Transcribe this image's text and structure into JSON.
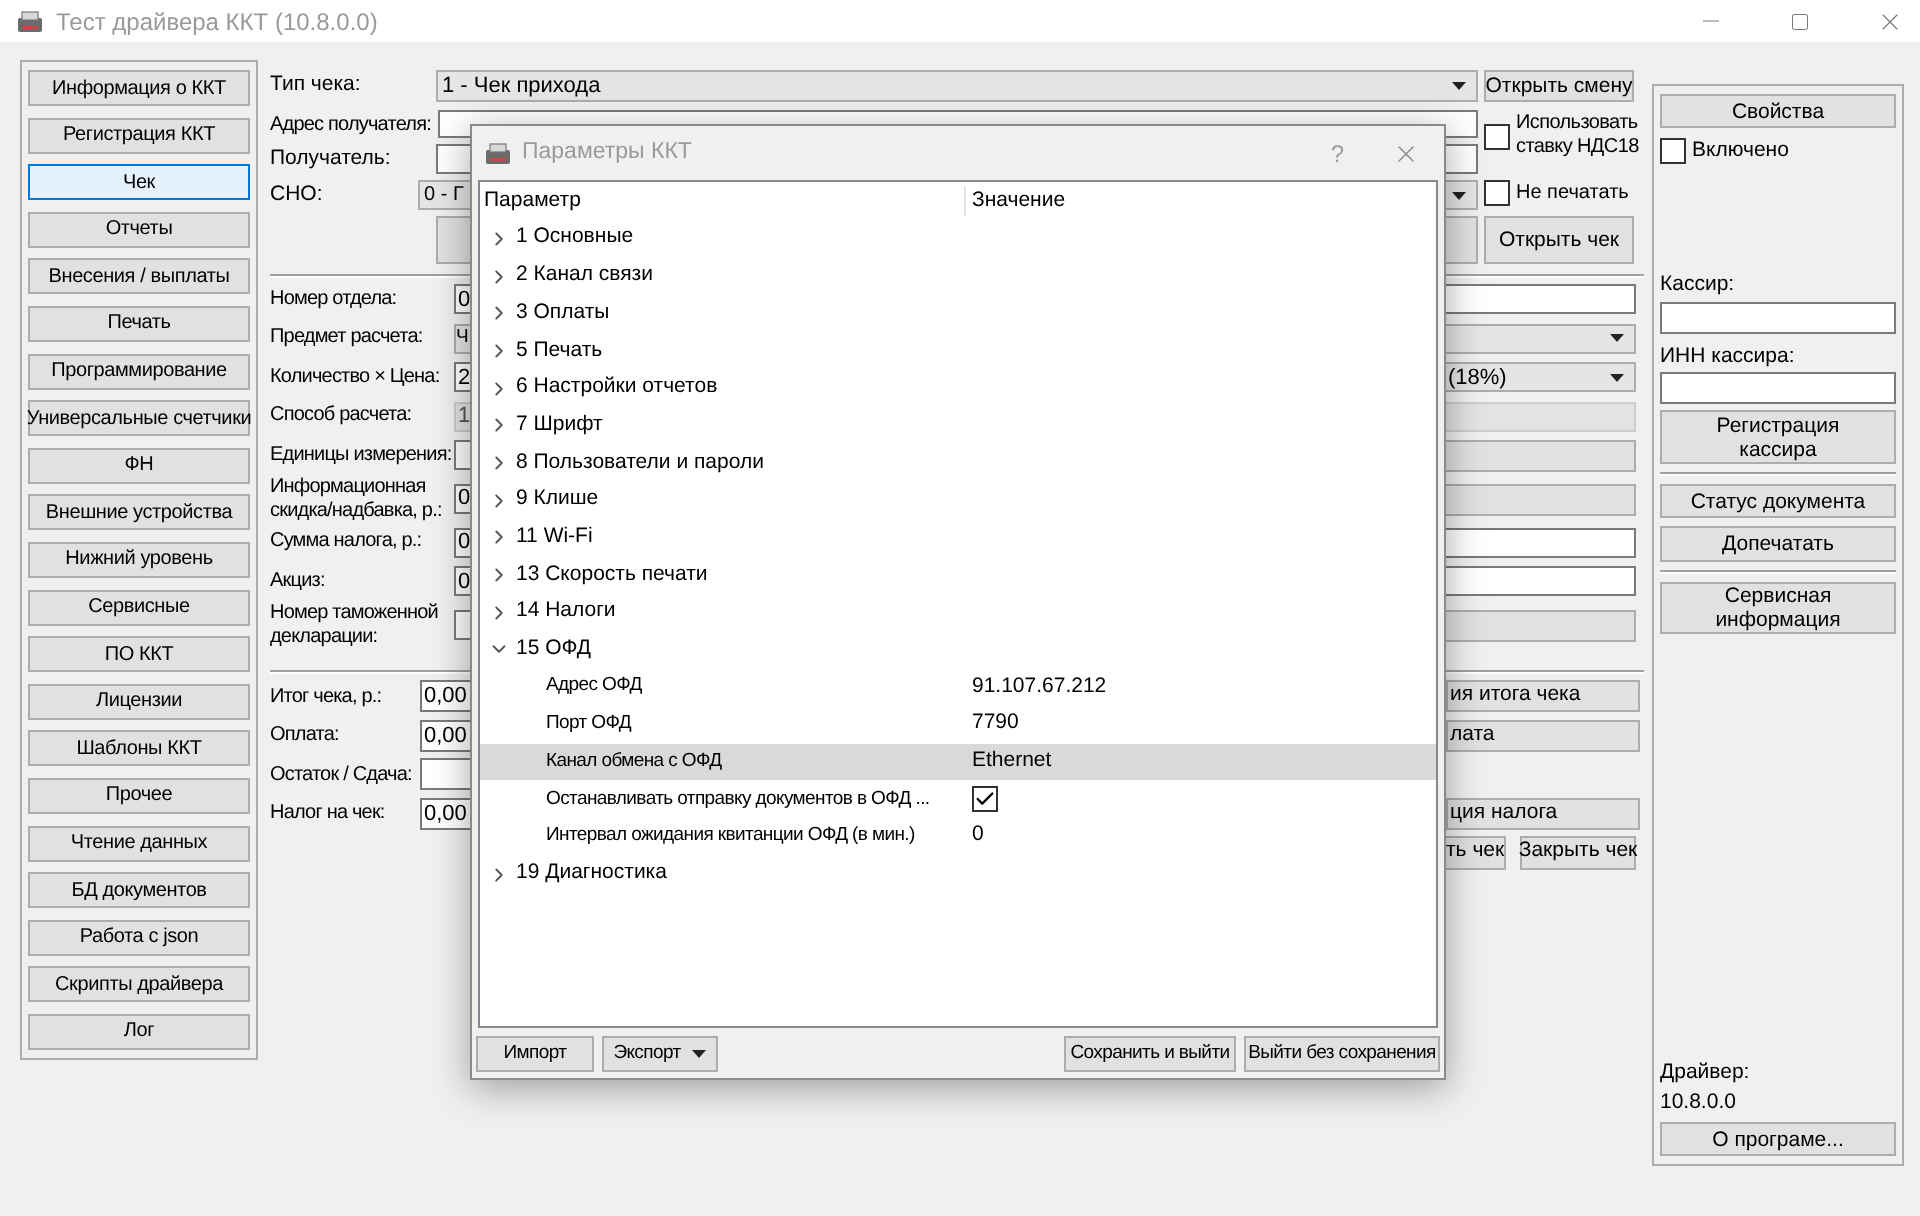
{
  "window": {
    "title": "Тест драйвера ККТ (10.8.0.0)"
  },
  "sidebar": {
    "items": [
      {
        "label": "Информация о ККТ",
        "selected": false
      },
      {
        "label": "Регистрация ККТ",
        "selected": false
      },
      {
        "label": "Чек",
        "selected": true
      },
      {
        "label": "Отчеты",
        "selected": false
      },
      {
        "label": "Внесения / выплаты",
        "selected": false
      },
      {
        "label": "Печать",
        "selected": false
      },
      {
        "label": "Программирование",
        "selected": false
      },
      {
        "label": "Универсальные счетчики",
        "selected": false
      },
      {
        "label": "ФН",
        "selected": false
      },
      {
        "label": "Внешние устройства",
        "selected": false
      },
      {
        "label": "Нижний уровень",
        "selected": false
      },
      {
        "label": "Сервисные",
        "selected": false
      },
      {
        "label": "ПО ККТ",
        "selected": false
      },
      {
        "label": "Лицензии",
        "selected": false
      },
      {
        "label": "Шаблоны ККТ",
        "selected": false
      },
      {
        "label": "Прочее",
        "selected": false
      },
      {
        "label": "Чтение данных",
        "selected": false
      },
      {
        "label": "БД документов",
        "selected": false
      },
      {
        "label": "Работа с json",
        "selected": false
      },
      {
        "label": "Скрипты драйвера",
        "selected": false
      },
      {
        "label": "Лог",
        "selected": false
      }
    ]
  },
  "header": {
    "receipt_type": {
      "label": "Тип чека:",
      "value": "1 - Чек прихода"
    },
    "address": {
      "label": "Адрес получателя:"
    },
    "recipient": {
      "label": "Получатель:"
    },
    "tax_system": {
      "label": "СНО:",
      "value": "0 - Г"
    },
    "open_shift": "Открыть смену",
    "use_vat18": {
      "label": "Использовать ставку НДС18",
      "checked": false
    },
    "no_print": {
      "label": "Не печатать",
      "checked": false
    },
    "open_receipt": "Открыть чек"
  },
  "item_fields": [
    {
      "label": "Номер отдела:",
      "kind": "input",
      "value": "0"
    },
    {
      "label": "Предмет расчета:",
      "kind": "dropdown",
      "value": "Ч"
    },
    {
      "label": "Количество × Цена:",
      "kind": "input",
      "value": "2",
      "right": {
        "kind": "dropdown",
        "value": "(18%)"
      }
    },
    {
      "label": "Способ расчета:",
      "kind": "disabled",
      "value": "1"
    },
    {
      "label": "Единицы измерения:",
      "kind": "input",
      "right": {
        "kind": "button"
      }
    },
    {
      "label": "Информационная скидка/надбавка, р.:",
      "kind": "input",
      "value": "0",
      "right": {
        "kind": "button"
      }
    },
    {
      "label": "Сумма налога, р.:",
      "kind": "input",
      "value": "0"
    },
    {
      "label": "Акциз:",
      "kind": "input",
      "value": "0"
    },
    {
      "label": "Номер таможенной декларации:",
      "kind": "input",
      "right": {
        "kind": "button"
      }
    }
  ],
  "totals": [
    {
      "label": "Итог чека, р.:",
      "value": "0,00",
      "button": "ия итога чека"
    },
    {
      "label": "Оплата:",
      "value": "0,00",
      "button": "лата"
    },
    {
      "label": "Остаток / Сдача:"
    },
    {
      "label": "Налог на чек:",
      "value": "0,00",
      "button": "ция налога"
    }
  ],
  "actions": [
    "ть чек",
    "Закрыть чек"
  ],
  "right_panel": {
    "properties": "Свойства",
    "enabled": {
      "label": "Включено",
      "checked": false
    },
    "cashier_label": "Кассир:",
    "inn_label": "ИНН кассира:",
    "register_cashier": "Регистрация кассира",
    "doc_status": "Статус документа",
    "reprint": "Допечатать",
    "service_info": "Сервисная информация",
    "driver_label": "Драйвер:",
    "driver_version": "10.8.0.0",
    "about": "О програме..."
  },
  "dialog": {
    "title": "Параметры ККТ",
    "help": "?",
    "columns": [
      "Параметр",
      "Значение"
    ],
    "groups": [
      {
        "label": "1 Основные",
        "expanded": false,
        "selected": false
      },
      {
        "label": "2 Канал связи",
        "expanded": false,
        "selected": false
      },
      {
        "label": "3 Оплаты",
        "expanded": false,
        "selected": false
      },
      {
        "label": "5 Печать",
        "expanded": false,
        "selected": false
      },
      {
        "label": "6 Настройки отчетов",
        "expanded": false,
        "selected": false
      },
      {
        "label": "7 Шрифт",
        "expanded": false,
        "selected": false
      },
      {
        "label": "8 Пользователи и пароли",
        "expanded": false,
        "selected": false
      },
      {
        "label": "9 Клише",
        "expanded": false,
        "selected": false
      },
      {
        "label": "11 Wi-Fi",
        "expanded": false,
        "selected": false
      },
      {
        "label": "13 Скорость печати",
        "expanded": false,
        "selected": false
      },
      {
        "label": "14 Налоги",
        "expanded": false,
        "selected": false
      },
      {
        "label": "15 ОФД",
        "expanded": true,
        "selected": false,
        "children": [
          {
            "kind": "text",
            "label": "Адрес ОФД",
            "value": "91.107.67.212",
            "selected": false
          },
          {
            "kind": "text",
            "label": "Порт ОФД",
            "value": "7790",
            "selected": false
          },
          {
            "kind": "text",
            "label": "Канал обмена с ОФД",
            "value": "Ethernet",
            "selected": true
          },
          {
            "kind": "checkbox",
            "label": "Останавливать отправку документов в ОФД ...",
            "checked": true,
            "selected": false
          },
          {
            "kind": "text",
            "label": "Интервал ожидания квитанции ОФД (в мин.)",
            "value": "0",
            "selected": false
          }
        ]
      },
      {
        "label": "19 Диагностика",
        "expanded": false,
        "selected": false
      }
    ],
    "buttons": {
      "import": "Импорт",
      "export": "Экспорт",
      "save": "Сохранить и выйти",
      "cancel": "Выйти без сохранения"
    }
  }
}
